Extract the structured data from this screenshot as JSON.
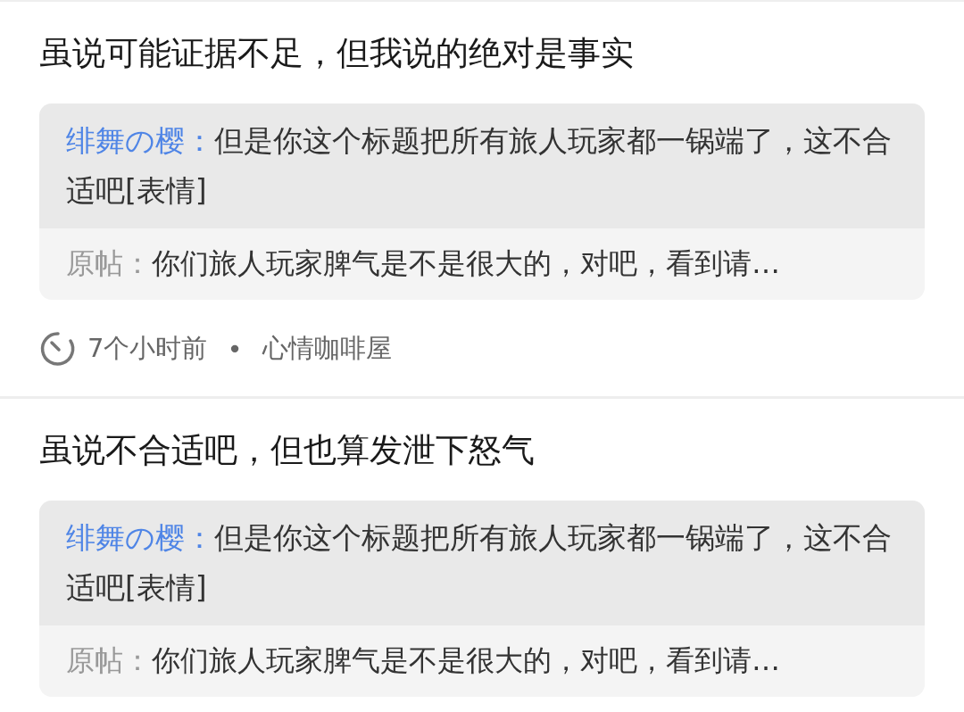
{
  "posts": [
    {
      "title": "虽说可能证据不足，但我说的绝对是事实",
      "quote": {
        "author": "绯舞の樱：",
        "text": "但是你这个标题把所有旅人玩家都一锅端了，这不合适吧[表情]"
      },
      "original": {
        "label": "原帖：",
        "text": "你们旅人玩家脾气是不是很大的，对吧，看到请…"
      },
      "meta": {
        "time": "7个小时前",
        "separator": "•",
        "forum": "心情咖啡屋"
      }
    },
    {
      "title": "虽说不合适吧，但也算发泄下怒气",
      "quote": {
        "author": "绯舞の樱：",
        "text": "但是你这个标题把所有旅人玩家都一锅端了，这不合适吧[表情]"
      },
      "original": {
        "label": "原帖：",
        "text": "你们旅人玩家脾气是不是很大的，对吧，看到请…"
      }
    }
  ]
}
